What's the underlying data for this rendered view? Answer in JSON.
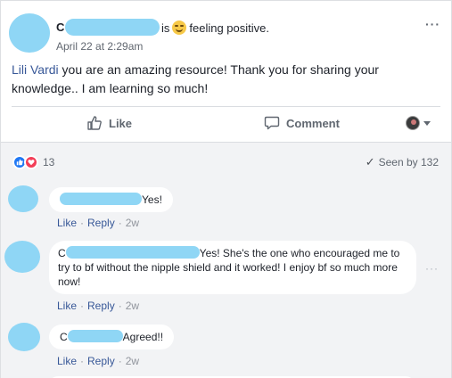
{
  "post": {
    "author_initial": "C",
    "action_text": "is",
    "feeling_text": "feeling positive.",
    "feeling_icon": "relieved-face-emoji",
    "timestamp": "April 22 at 2:29am",
    "mention": "Lili Vardi",
    "body": " you are an amazing resource! Thank you for sharing your knowledge.. I am learning so much!"
  },
  "actions": {
    "like_label": "Like",
    "comment_label": "Comment"
  },
  "summary": {
    "reaction_count": "13",
    "seen_by": "Seen by 132"
  },
  "comments": [
    {
      "initial": "",
      "text": "Yes!",
      "like": "Like",
      "reply": "Reply",
      "age": "2w"
    },
    {
      "initial": "C",
      "text": "Yes! She's the one who encouraged me to try to bf without the nipple shield and it worked! I enjoy bf so much more now!",
      "like": "Like",
      "reply": "Reply",
      "age": "2w"
    },
    {
      "initial": "C",
      "text": "Agreed!!",
      "like": "Like",
      "reply": "Reply",
      "age": "2w"
    }
  ],
  "colors": {
    "redaction": "#8fd6f5",
    "link": "#385898",
    "like_reaction": "#2078f4",
    "love_reaction": "#f33e58"
  }
}
